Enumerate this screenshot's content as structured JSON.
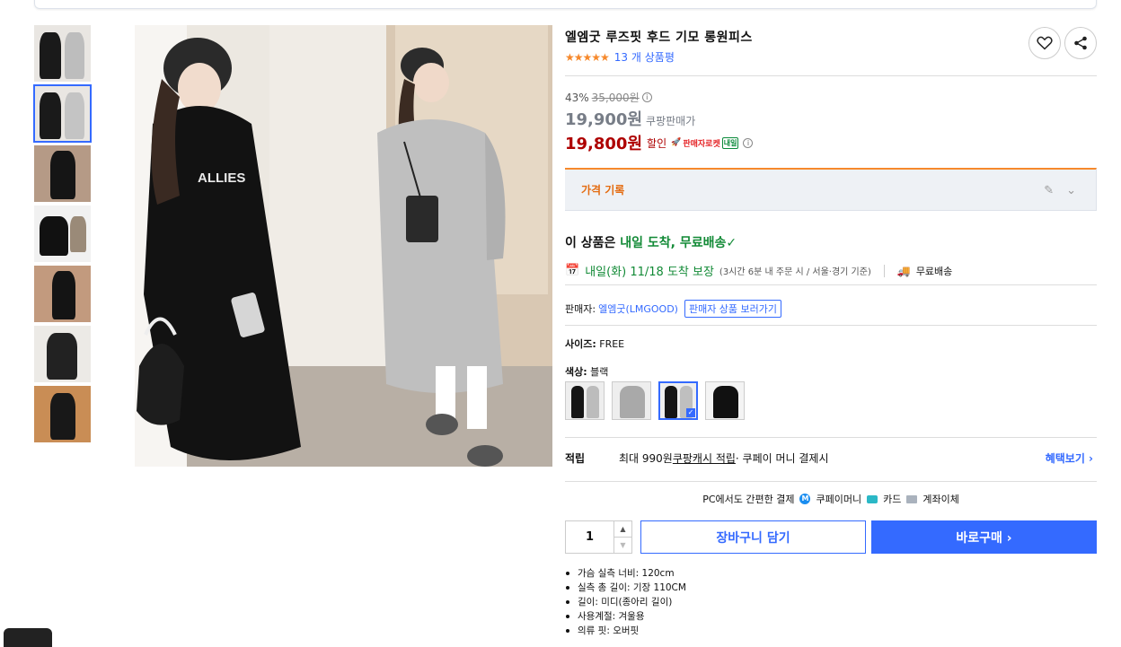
{
  "product": {
    "title": "엘엠굿 루즈핏 후드 기모 롱원피스",
    "rating_stars": "★★★★★",
    "review_count": "13 개 상품평"
  },
  "price": {
    "discount_rate": "43%",
    "original": "35,000원",
    "coupang_price": "19,900원",
    "coupang_price_label": "쿠팡판매가",
    "sale_price": "19,800원",
    "sale_label": "할인",
    "rocket_label": "판매자로켓",
    "naeil_badge": "내일"
  },
  "price_history": {
    "label": "가격 기록"
  },
  "delivery": {
    "head_prefix": "이 상품은 ",
    "head_green": "내일 도착, 무료배송",
    "date_text": "내일(화) 11/18 도착 보장",
    "condition": "(3시간 6분 내 주문 시 / 서울·경기 기준)",
    "free_shipping": "무료배송"
  },
  "seller": {
    "label": "판매자:",
    "name": "엘엠굿(LMGOOD)",
    "view_button": "판매자 상품 보러가기"
  },
  "options": {
    "size_label": "사이즈:",
    "size_value": "FREE",
    "color_label": "색상:",
    "color_value": "블랙"
  },
  "reward": {
    "label": "적립",
    "text_a": "최대 990원 ",
    "text_link": "쿠팡캐시 적립",
    "text_b": " · 쿠페이 머니 결제시",
    "more": "혜택보기 ›"
  },
  "payment": {
    "title": "PC에서도 간편한 결제",
    "coupay": "쿠페이머니",
    "card": "카드",
    "bank": "계좌이체"
  },
  "purchase": {
    "quantity": "1",
    "cart_button": "장바구니 담기",
    "buy_button": "바로구매  ›"
  },
  "specs": [
    "가슴 실측 너비: 120cm",
    "실측 총 길이: 기장 110CM",
    "길이: 미디(종아리 길이)",
    "사용계절: 겨울용",
    "의류 핏: 오버핏"
  ],
  "main_image": {
    "print_text": "ALLIES"
  },
  "colors": {
    "accent": "#346aff",
    "price_red": "#ae0000",
    "green": "#128a36",
    "orange": "#f6892c"
  }
}
